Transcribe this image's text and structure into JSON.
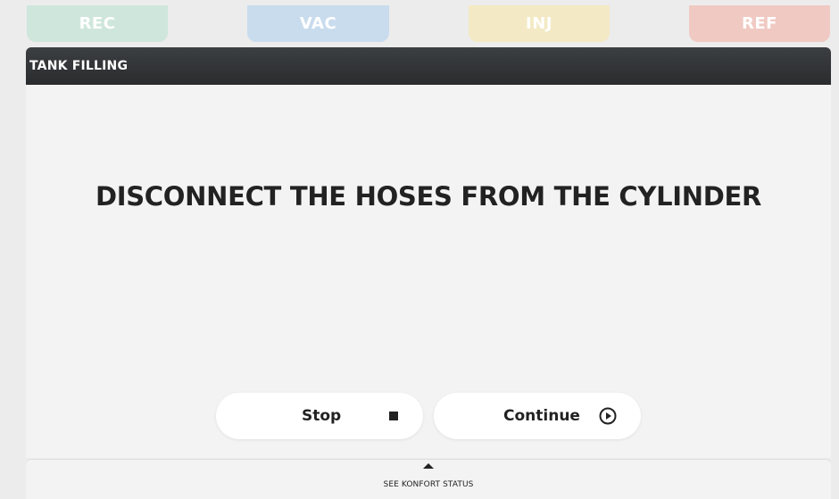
{
  "modes": {
    "rec": {
      "label": "REC",
      "color": "#cfe6dc"
    },
    "vac": {
      "label": "VAC",
      "color": "#c9dcee"
    },
    "inj": {
      "label": "INJ",
      "color": "#f3e9c4"
    },
    "ref": {
      "label": "REF",
      "color": "#f0c9c2"
    }
  },
  "panel": {
    "title": "TANK FILLING",
    "message": "DISCONNECT THE HOSES FROM THE CYLINDER"
  },
  "actions": {
    "stop_label": "Stop",
    "stop_icon": "stop-icon",
    "continue_label": "Continue",
    "continue_icon": "play-circle-icon"
  },
  "status_drawer": {
    "label": "SEE KONFORT STATUS",
    "icon": "caret-up-icon"
  }
}
